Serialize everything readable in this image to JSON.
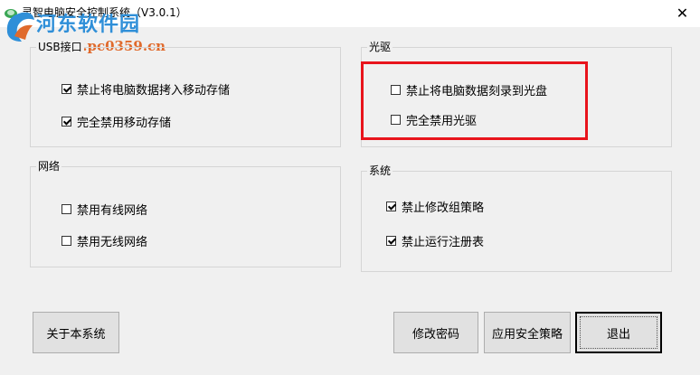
{
  "window": {
    "title": "灵智电脑安全控制系统（V3.0.1）",
    "close_glyph": "✕"
  },
  "watermark": {
    "site_name": "河东软件园",
    "url": "www.pc0359.cn"
  },
  "groups": {
    "usb": {
      "label": "USB接口",
      "options": [
        {
          "label": "禁止将电脑数据拷入移动存储",
          "checked": true
        },
        {
          "label": "完全禁用移动存储",
          "checked": true
        }
      ]
    },
    "optical": {
      "label": "光驱",
      "options": [
        {
          "label": "禁止将电脑数据刻录到光盘",
          "checked": false
        },
        {
          "label": "完全禁用光驱",
          "checked": false
        }
      ]
    },
    "network": {
      "label": "网络",
      "options": [
        {
          "label": "禁用有线网络",
          "checked": false
        },
        {
          "label": "禁用无线网络",
          "checked": false
        }
      ]
    },
    "system": {
      "label": "系统",
      "options": [
        {
          "label": "禁止修改组策略",
          "checked": true
        },
        {
          "label": "禁止运行注册表",
          "checked": true
        }
      ]
    }
  },
  "buttons": {
    "about": "关于本系统",
    "change_password": "修改密码",
    "apply_policy": "应用安全策略",
    "exit": "退出"
  },
  "colors": {
    "highlight_border": "#e8141c",
    "watermark_blue": "#2f8fd8",
    "watermark_orange": "#e06a2c"
  }
}
